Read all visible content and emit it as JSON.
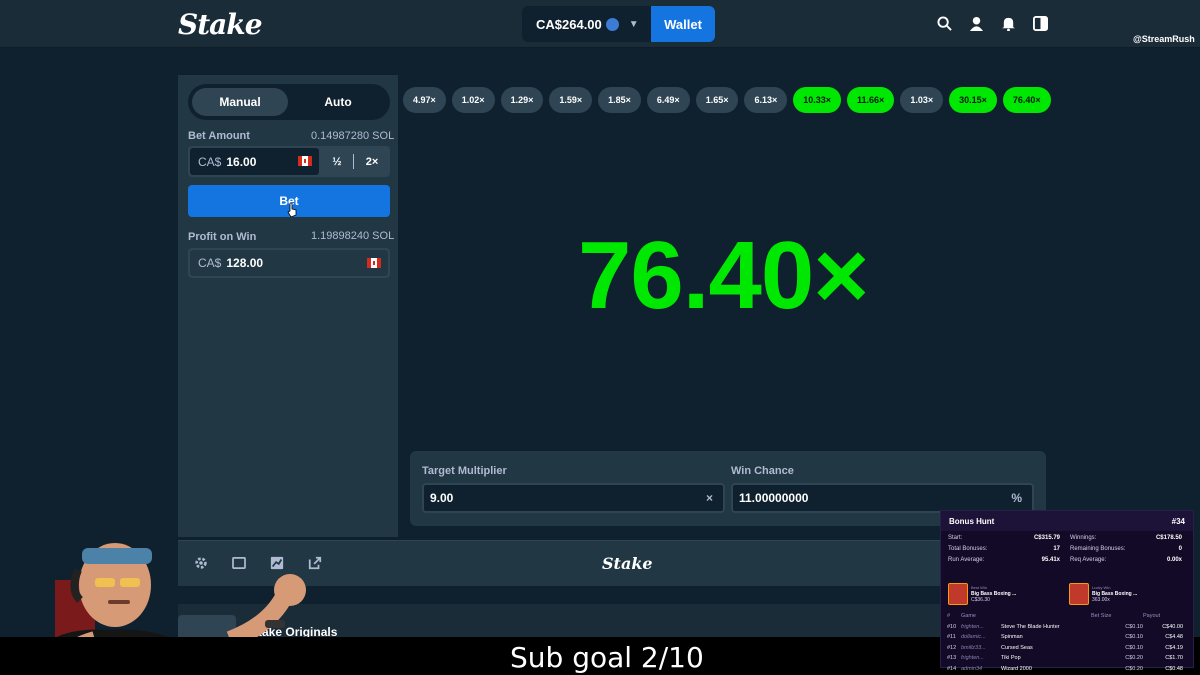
{
  "header": {
    "logo": "Stake",
    "balance": "CA$264.00",
    "wallet_label": "Wallet",
    "icons": [
      "search-icon",
      "user-icon",
      "bell-icon",
      "sidebar-toggle-icon"
    ],
    "watermark": "@StreamRush"
  },
  "sidebar": {
    "tabs": [
      "Manual",
      "Auto"
    ],
    "bet_amount_label": "Bet Amount",
    "bet_amount_crypto": "0.14987280 SOL",
    "bet_currency": "CA$",
    "bet_value": "16.00",
    "half_label": "½",
    "double_label": "2×",
    "bet_button": "Bet",
    "profit_label": "Profit on Win",
    "profit_crypto": "1.19898240 SOL",
    "profit_currency": "CA$",
    "profit_value": "128.00"
  },
  "history": [
    "4.97×",
    "1.02×",
    "1.29×",
    "1.59×",
    "1.85×",
    "6.49×",
    "1.65×",
    "6.13×",
    "10.33×",
    "11.66×",
    "1.03×",
    "30.15×",
    "76.40×"
  ],
  "history_wins": [
    false,
    false,
    false,
    false,
    false,
    false,
    false,
    false,
    true,
    true,
    false,
    true,
    true
  ],
  "result": "76.40×",
  "colors": {
    "win": "#00e701",
    "accent": "#1475e1",
    "panel": "#213743",
    "bg": "#0f212e"
  },
  "controls": {
    "target_label": "Target Multiplier",
    "target_value": "9.00",
    "chance_label": "Win Chance",
    "chance_value": "11.00000000",
    "chance_suffix": "%",
    "clear_icon": "×"
  },
  "footer": {
    "logo": "Stake",
    "icons": [
      "gear-icon",
      "theater-icon",
      "stats-icon",
      "popout-icon"
    ],
    "originals_label": "Stake Originals"
  },
  "overlay": {
    "subgoal": "Sub goal 2/10"
  },
  "bonus_hunt": {
    "title": "Bonus Hunt",
    "number": "#34",
    "left_stats": [
      {
        "label": "Start:",
        "value": "C$315.79"
      },
      {
        "label": "Total Bonuses:",
        "value": "17"
      },
      {
        "label": "Run Average:",
        "value": "95.41x"
      }
    ],
    "right_stats": [
      {
        "label": "Winnings:",
        "value": "C$178.50"
      },
      {
        "label": "Remaining Bonuses:",
        "value": "0"
      },
      {
        "label": "Req Average:",
        "value": "0.00x"
      }
    ],
    "best": {
      "tag": "Best Win",
      "name": "Big Bass Boxing ...",
      "amount": "C$36.30"
    },
    "lucky": {
      "tag": "Lucky Win",
      "name": "Big Bass Boxing ...",
      "amount": "363.00x"
    },
    "columns": [
      "#",
      "Game",
      "",
      "Bet Size",
      "Payout"
    ],
    "rows": [
      {
        "num": "#10",
        "user": "frighten...",
        "game": "Steve The Blade Hunter",
        "bet": "C$0.10",
        "payout": "C$40.00"
      },
      {
        "num": "#11",
        "user": "dollamic...",
        "game": "Spinman",
        "bet": "C$0.10",
        "payout": "C$4.48"
      },
      {
        "num": "#12",
        "user": "bmillz33...",
        "game": "Cursed Seas",
        "bet": "C$0.10",
        "payout": "C$4.19"
      },
      {
        "num": "#13",
        "user": "frighten...",
        "game": "Tiki Pop",
        "bet": "C$0.20",
        "payout": "C$1.70"
      },
      {
        "num": "#14",
        "user": "admin34",
        "game": "Wizard 2000",
        "bet": "C$0.20",
        "payout": "C$0.48"
      }
    ]
  }
}
